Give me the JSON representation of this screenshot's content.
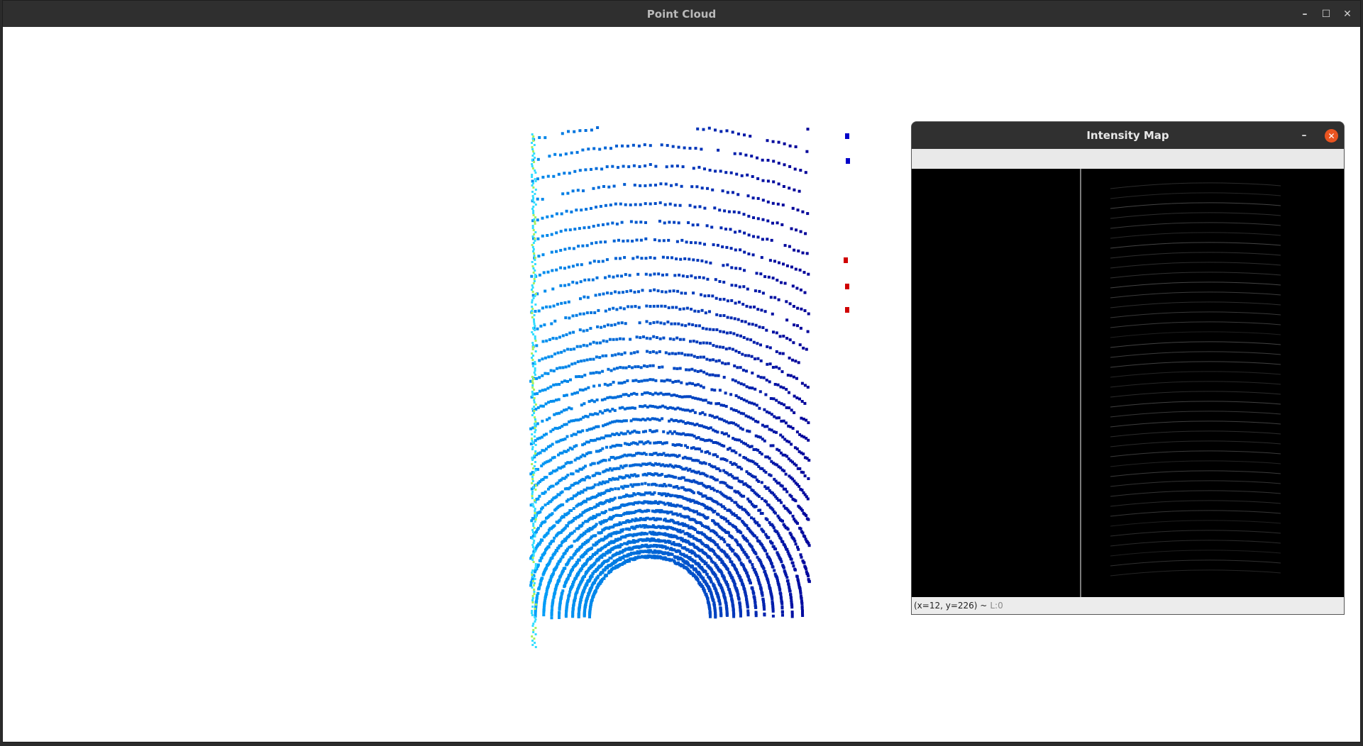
{
  "main_window": {
    "title": "Point Cloud",
    "controls": {
      "minimize": "–",
      "maximize": "☐",
      "close": "✕"
    }
  },
  "intensity_window": {
    "title": "Intensity Map",
    "controls": {
      "minimize": "–",
      "close": "✕"
    },
    "status": {
      "coords": "(x=12, y=226) ~",
      "level": "L:0"
    }
  },
  "colors": {
    "titlebar": "#2f2f2f",
    "close_accent": "#e95420",
    "cloud_near": "#00a8ff",
    "cloud_far": "#0000a0"
  }
}
